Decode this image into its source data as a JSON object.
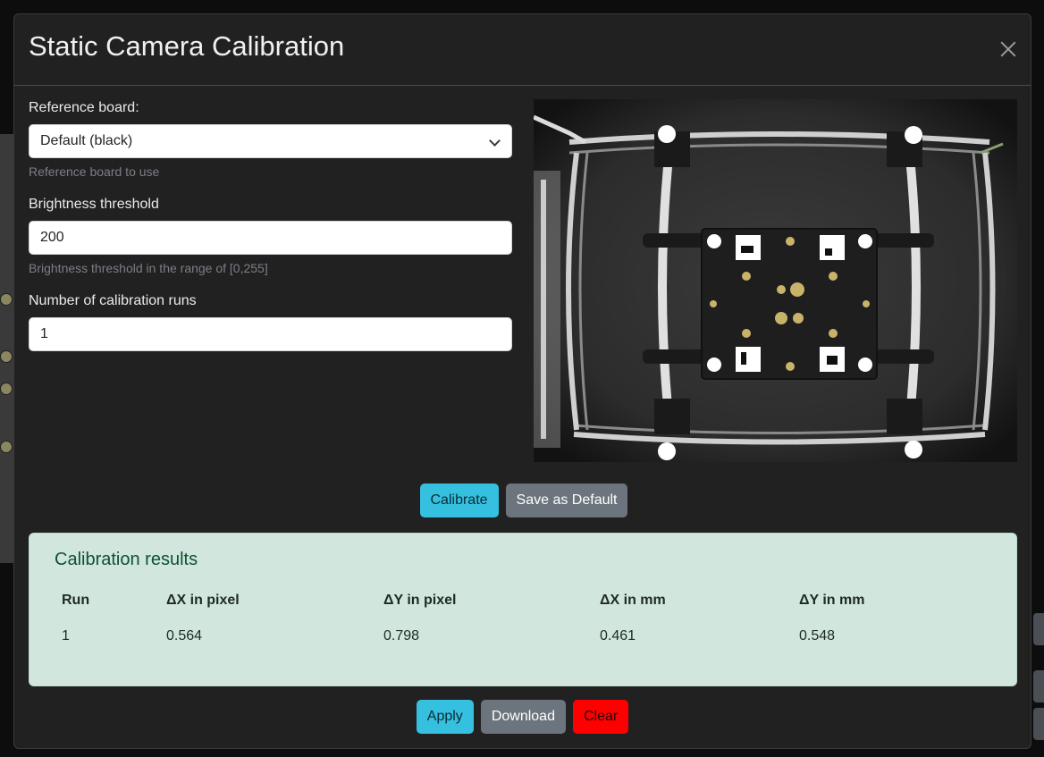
{
  "modal": {
    "title": "Static Camera Calibration",
    "close_icon": "close-icon"
  },
  "form": {
    "board": {
      "label": "Reference board:",
      "selected": "Default (black)",
      "help": "Reference board to use"
    },
    "threshold": {
      "label": "Brightness threshold",
      "value": "200",
      "help": "Brightness threshold in the range of [0,255]"
    },
    "runs": {
      "label": "Number of calibration runs",
      "value": "1"
    }
  },
  "camera": {
    "image_icon": "camera-feed"
  },
  "actions": {
    "calibrate": "Calibrate",
    "save_default": "Save as Default"
  },
  "results": {
    "title": "Calibration results",
    "headers": [
      "Run",
      "ΔX in pixel",
      "ΔY in pixel",
      "ΔX in mm",
      "ΔY in mm"
    ],
    "rows": [
      [
        "1",
        "0.564",
        "0.798",
        "0.461",
        "0.548"
      ]
    ]
  },
  "footer": {
    "apply": "Apply",
    "download": "Download",
    "clear": "Clear"
  },
  "colors": {
    "info": "#35c0e0",
    "secondary": "#6c757d",
    "danger": "#ff0000",
    "success_bg": "#d1e7dd"
  }
}
